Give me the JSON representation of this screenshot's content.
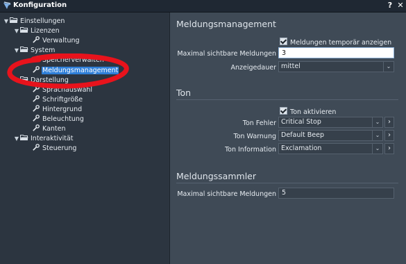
{
  "window": {
    "title": "Konfiguration",
    "help": "?",
    "close": "✕"
  },
  "tree": {
    "root": "Einstellungen",
    "lizenzen": "Lizenzen",
    "verwaltung": "Verwaltung",
    "system": "System",
    "speicherverwalten": "Speicherverwalten",
    "meldungsmanagement": "Meldungsmanagement",
    "darstellung": "Darstellung",
    "sprachauswahl": "Sprachauswahl",
    "schriftgroesse": "Schriftgröße",
    "hintergrund": "Hintergrund",
    "beleuchtung": "Beleuchtung",
    "kanten": "Kanten",
    "interaktivitaet": "Interaktivität",
    "steuerung": "Steuerung"
  },
  "meldungsmanagement": {
    "title": "Meldungsmanagement",
    "temp_show_label": "Meldungen temporär anzeigen",
    "max_visible_label": "Maximal sichtbare Meldungen",
    "max_visible_value": "3",
    "duration_label": "Anzeigedauer",
    "duration_value": "mittel"
  },
  "ton": {
    "title": "Ton",
    "activate_label": "Ton aktivieren",
    "error_label": "Ton Fehler",
    "error_value": "Critical Stop",
    "warning_label": "Ton Warnung",
    "warning_value": "Default Beep",
    "info_label": "Ton Information",
    "info_value": "Exclamation"
  },
  "sammler": {
    "title": "Meldungssammler",
    "max_visible_label": "Maximal sichtbare Meldungen",
    "max_visible_value": "5"
  },
  "colors": {
    "selection": "#2f7fd8",
    "annotation": "#e8131c"
  }
}
